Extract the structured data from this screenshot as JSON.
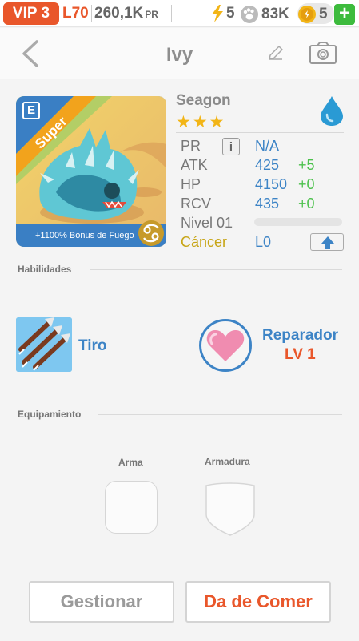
{
  "status": {
    "vip": "VIP 3",
    "level": "L70",
    "pr_value": "260,1K",
    "pr_unit": "PR",
    "energy": "5",
    "food": "83K",
    "coins": "5",
    "add": "+"
  },
  "header": {
    "title": "Ivy"
  },
  "pet": {
    "name": "Seagon",
    "rank_label": "Super",
    "portrait_tag": "E",
    "bonus": "+1100% Bonus de Fuego",
    "star_count": 3,
    "stars": "★★★",
    "stats": {
      "pr_label": "PR",
      "pr_value": "N/A",
      "atk_label": "ATK",
      "atk_value": "425",
      "atk_delta": "+5",
      "hp_label": "HP",
      "hp_value": "4150",
      "hp_delta": "+0",
      "rcv_label": "RCV",
      "rcv_value": "435",
      "rcv_delta": "+0",
      "nivel_label": "Nivel 01",
      "nivel_progress": 0,
      "sign_label": "Cáncer",
      "sign_value": "L0"
    }
  },
  "skills": {
    "section": "Habilidades",
    "skill1": "Tiro",
    "skill2": "Reparador",
    "skill2_level": "LV 1"
  },
  "equipment": {
    "section": "Equipamiento",
    "weapon": "Arma",
    "armor": "Armadura"
  },
  "actions": {
    "manage": "Gestionar",
    "feed": "Da de Comer"
  },
  "colors": {
    "accent_orange": "#e9572b",
    "accent_blue": "#3d84c6",
    "positive_green": "#4cc14c",
    "gold": "#c7a516"
  }
}
